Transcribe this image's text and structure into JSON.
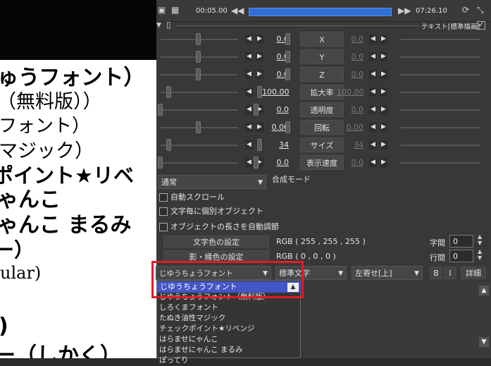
{
  "preview": {
    "lines": [
      "ゅうフォント）",
      "（無料版））",
      "フォント）",
      "マジック）",
      "ポイント★リベ",
      "ゃんこ",
      "ゃんこ まるみ",
      "ー）",
      "ular)",
      ")",
      "ー（しかく）"
    ]
  },
  "topbar": {
    "start_time": "00:05.00",
    "end_time": "07:26.10",
    "object_type": "テキスト[標準描画]"
  },
  "params": [
    {
      "left_value": "0.0",
      "label": "X",
      "right_value": "0.0"
    },
    {
      "left_value": "0.0",
      "label": "Y",
      "right_value": "0.0"
    },
    {
      "left_value": "0.0",
      "label": "Z",
      "right_value": "0.0"
    },
    {
      "left_value": "100.00",
      "label": "拡大率",
      "right_value": "100.00"
    },
    {
      "left_value": "0.0",
      "label": "透明度",
      "right_value": "0.0"
    },
    {
      "left_value": "0.00",
      "label": "回転",
      "right_value": "0.00"
    },
    {
      "left_value": "34",
      "label": "サイズ",
      "right_value": "34"
    },
    {
      "left_value": "0.0",
      "label": "表示速度",
      "right_value": "0.0"
    }
  ],
  "blend": {
    "value": "通常",
    "label": "合成モード"
  },
  "checkboxes": [
    "自動スクロール",
    "文字毎に個別オブジェクト",
    "オブジェクトの長さを自動調節"
  ],
  "color_settings": {
    "text_color_button": "文字色の設定",
    "text_color_value": "RGB ( 255 , 255 , 255 )",
    "shadow_color_button": "影・縁色の設定",
    "shadow_color_value": "RGB ( 0 , 0 , 0 )",
    "char_spacing_label": "字間",
    "char_spacing_value": "0",
    "line_spacing_label": "行間",
    "line_spacing_value": "0"
  },
  "font_combo": {
    "value": "じゆうちょうフォント"
  },
  "style_combo": {
    "value": "標準文字"
  },
  "align_combo": {
    "value": "左寄せ[上]"
  },
  "buttons": {
    "bold": "B",
    "italic": "I",
    "detail": "詳細"
  },
  "font_list": {
    "selected": "じゆうちょうフォント",
    "items": [
      "じゆうちょうフォント（無料版）",
      "しろくまフォント",
      "たぬき油性マジック",
      "チェックポイント★リベンジ",
      "はらませにゃんこ",
      "はらませにゃんこ まるみ",
      "ぽってり"
    ]
  },
  "colors": {
    "accent": "#4455c8",
    "highlight": "#e21b25",
    "timeline": "#2f6fd6"
  }
}
